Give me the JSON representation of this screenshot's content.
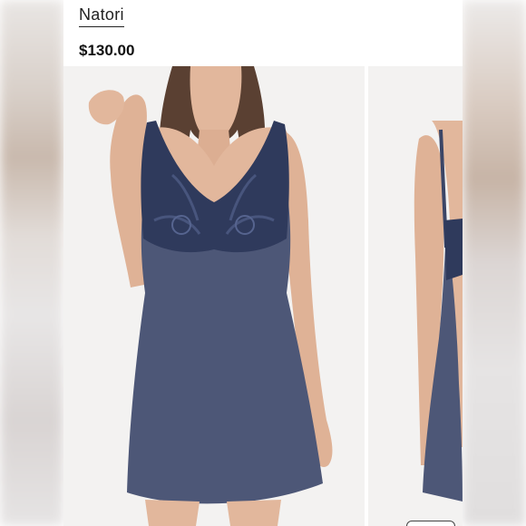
{
  "product": {
    "brand": "Natori",
    "price": "$130.00"
  },
  "gallery": {
    "main_image": "model-wearing-navy-lace-chemise",
    "side_image": "model-back-view-chemise",
    "colors": {
      "dress": "#4d5777",
      "lace": "#2f3a5c",
      "skin": "#e2b79c",
      "hair": "#5a4032",
      "background": "#f3f2f1"
    }
  }
}
